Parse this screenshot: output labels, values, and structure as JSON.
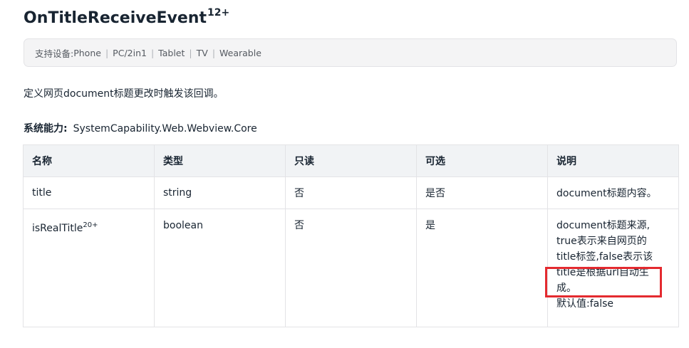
{
  "title": {
    "text": "OnTitleReceiveEvent",
    "sup": "12+"
  },
  "devices": {
    "prefix": "支持设备: ",
    "items": [
      "Phone",
      "PC/2in1",
      "Tablet",
      "TV",
      "Wearable"
    ],
    "separator": "|"
  },
  "description": "定义网页document标题更改时触发该回调。",
  "syscap": {
    "label": "系统能力:",
    "value": "SystemCapability.Web.Webview.Core"
  },
  "table": {
    "headers": [
      "名称",
      "类型",
      "只读",
      "可选",
      "说明"
    ],
    "rows": [
      {
        "name": "title",
        "sup": "",
        "type": "string",
        "readonly": "否",
        "optional": "是否",
        "desc": [
          "document标题内容。"
        ]
      },
      {
        "name": "isRealTitle",
        "sup": "20+",
        "type": "boolean",
        "readonly": "否",
        "optional": "是",
        "desc": [
          "document标题来源,",
          "true表示来自网页的",
          "title标签,false表示该",
          "title是根据url自动生",
          "成。",
          "默认值:false"
        ]
      }
    ]
  },
  "colors": {
    "highlight": "#e42a2f",
    "header_bg": "#f1f3f5",
    "border": "#e3e3e6",
    "text": "#182431"
  }
}
